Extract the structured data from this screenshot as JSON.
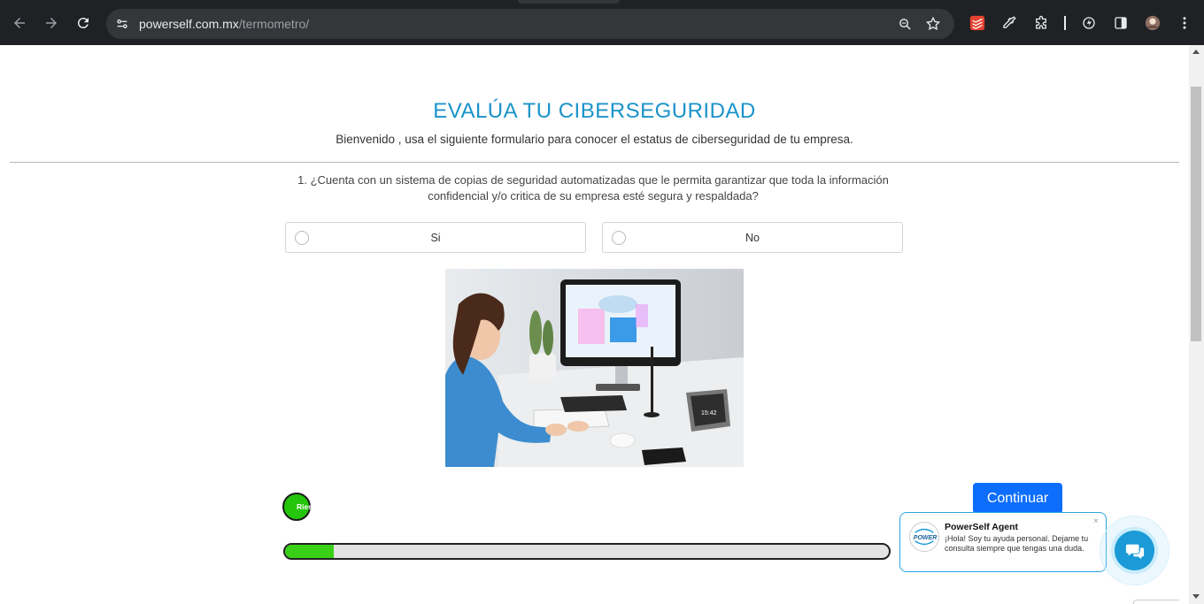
{
  "browser": {
    "url_host": "powerself.com.mx",
    "url_path": "/termometro/"
  },
  "page": {
    "title": "EVALÚA TU CIBERSEGURIDAD",
    "subtitle": "Bienvenido , usa el siguiente formulario para conocer el estatus de ciberseguridad de tu empresa.",
    "question": "1. ¿Cuenta con un sistema de copias de seguridad automatizadas que le permita garantizar que toda la información confidencial y/o critica de su empresa esté segura y respaldada?",
    "options": [
      {
        "label": "Si"
      },
      {
        "label": "No"
      }
    ],
    "photo_icon": "woman-at-computer-photo",
    "monitor_clock": "15:42",
    "continue_label": "Continuar",
    "progress": {
      "label": "Riesgo",
      "fraction": 0.08,
      "color": "#39d016"
    }
  },
  "chat": {
    "agent_name": "PowerSelf Agent",
    "message": "¡Hola! Soy tu ayuda personal. Dejame tu consulta siempre que tengas una duda.",
    "avatar_text": "POWER",
    "close_label": "×"
  },
  "colors": {
    "title": "#1a93c9",
    "button": "#0d6efd",
    "chat": "#1a9ad6"
  }
}
